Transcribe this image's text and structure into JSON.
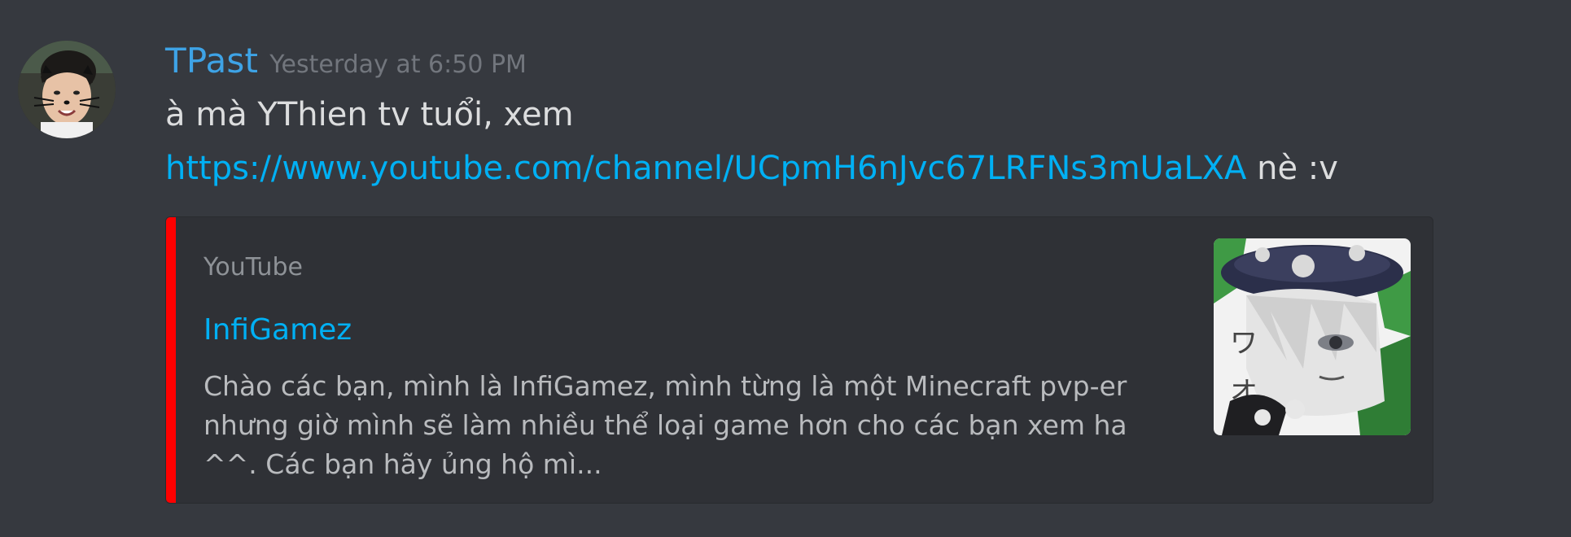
{
  "message": {
    "author": "TPast",
    "timestamp": "Yesterday at 6:50 PM",
    "line1": "à mà YThien tv tuổi, xem",
    "link": "https://www.youtube.com/channel/UCpmH6nJvc67LRFNs3mUaLXA",
    "link_suffix": " nè :v"
  },
  "embed": {
    "provider": "YouTube",
    "title": "InfiGamez",
    "description": "Chào các bạn, mình là InfiGamez, mình từng là một Minecraft pvp-er nhưng giờ mình sẽ làm nhiều thể loại game hơn cho các bạn xem ha ^^. Các bạn hãy ủng hộ mì...",
    "accent_color": "#ff0000",
    "thumbnail_icon": "anime-character-thumbnail"
  },
  "icons": {
    "avatar": "user-avatar-image",
    "dismiss": "close-icon"
  },
  "colors": {
    "background": "#36393f",
    "username": "#3ea3e6",
    "link": "#00b0f4",
    "embed_background": "#2f3136"
  }
}
